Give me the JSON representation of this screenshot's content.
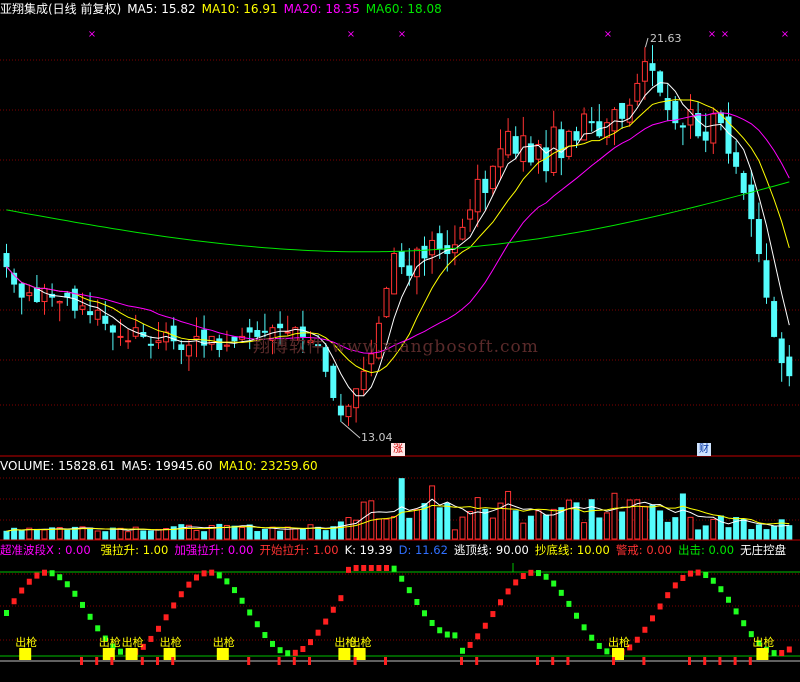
{
  "price_header": {
    "title": "亚翔集成(日线 前复权)",
    "ma5": "MA5: 15.82",
    "ma10": "MA10: 16.91",
    "ma20": "MA20: 18.35",
    "ma60": "MA60: 18.08"
  },
  "volume_header": {
    "volume": "VOLUME: 15828.61",
    "ma5": "MA5: 19945.60",
    "ma10": "MA10: 23259.60"
  },
  "indicator_header": {
    "x": "超准波段X : 0.00",
    "qianglasheng": "强拉升: 1.00",
    "jiaqianglasheng": "加强拉升: 0.00",
    "kaishilasheng": "开始拉升: 1.00",
    "k": "K: 19.39",
    "d": "D: 11.62",
    "taodingxian": "逃顶线: 90.00",
    "chaodixian": "抄底线: 10.00",
    "jingjie": "警戒: 0.00",
    "chuji": "出击: 0.00",
    "wuzhuangkongpan": "无庄控盘"
  },
  "price_labels": {
    "high": "21.63",
    "low": "13.04"
  },
  "badges": {
    "zhang": "涨",
    "cai": "财"
  },
  "signal_label": "出枪",
  "watermark": "翔博软件 www.xiangbosoft.com",
  "colors": {
    "up": "#ff3232",
    "down": "#54fcfc",
    "ma5": "#ffffff",
    "ma10": "#ffff00",
    "ma20": "#ff00ff",
    "ma60": "#00e600",
    "grid": "#800000"
  },
  "chart_data": {
    "type": "candlestick",
    "title": "亚翔集成(日线 前复权)",
    "price_range_visible": [
      13.04,
      21.63
    ],
    "high_marker": 21.63,
    "low_marker": 13.04,
    "moving_averages": {
      "MA5": 15.82,
      "MA10": 16.91,
      "MA20": 18.35,
      "MA60": 18.08
    },
    "volume": {
      "VOLUME": 15828.61,
      "MA5": 19945.6,
      "MA10": 23259.6
    },
    "indicator": {
      "超准波段X": 0.0,
      "强拉升": 1.0,
      "加强拉升": 0.0,
      "开始拉升": 1.0,
      "K": 19.39,
      "D": 11.62,
      "逃顶线": 90.0,
      "抄底线": 10.0,
      "警戒": 0.0,
      "出击": 0.0
    },
    "closes": [
      16.6,
      16.2,
      15.9,
      16.0,
      15.8,
      16.1,
      15.9,
      15.8,
      15.9,
      15.6,
      15.7,
      15.5,
      15.6,
      15.3,
      15.1,
      15.0,
      14.9,
      15.2,
      15.0,
      14.8,
      14.9,
      15.1,
      14.9,
      14.7,
      14.8,
      15.0,
      14.8,
      15.0,
      14.7,
      14.8,
      14.9,
      15.0,
      15.1,
      15.0,
      15.1,
      15.2,
      15.2,
      15.1,
      15.2,
      15.0,
      14.9,
      14.8,
      14.2,
      13.6,
      13.2,
      13.4,
      13.8,
      14.2,
      14.6,
      15.3,
      16.1,
      16.9,
      16.6,
      16.4,
      17.0,
      16.8,
      17.2,
      17.0,
      16.9,
      17.1,
      17.5,
      17.9,
      18.6,
      18.3,
      18.9,
      19.3,
      19.7,
      19.2,
      19.6,
      19.0,
      19.4,
      18.8,
      19.8,
      19.1,
      19.7,
      19.5,
      20.1,
      19.9,
      19.6,
      19.9,
      20.2,
      20.0,
      20.3,
      20.8,
      21.3,
      21.1,
      20.6,
      20.2,
      19.9,
      19.8,
      20.2,
      19.6,
      19.5,
      20.1,
      19.9,
      19.2,
      18.9,
      18.3,
      17.7,
      16.9,
      15.9,
      15.0,
      14.4,
      14.1
    ]
  }
}
